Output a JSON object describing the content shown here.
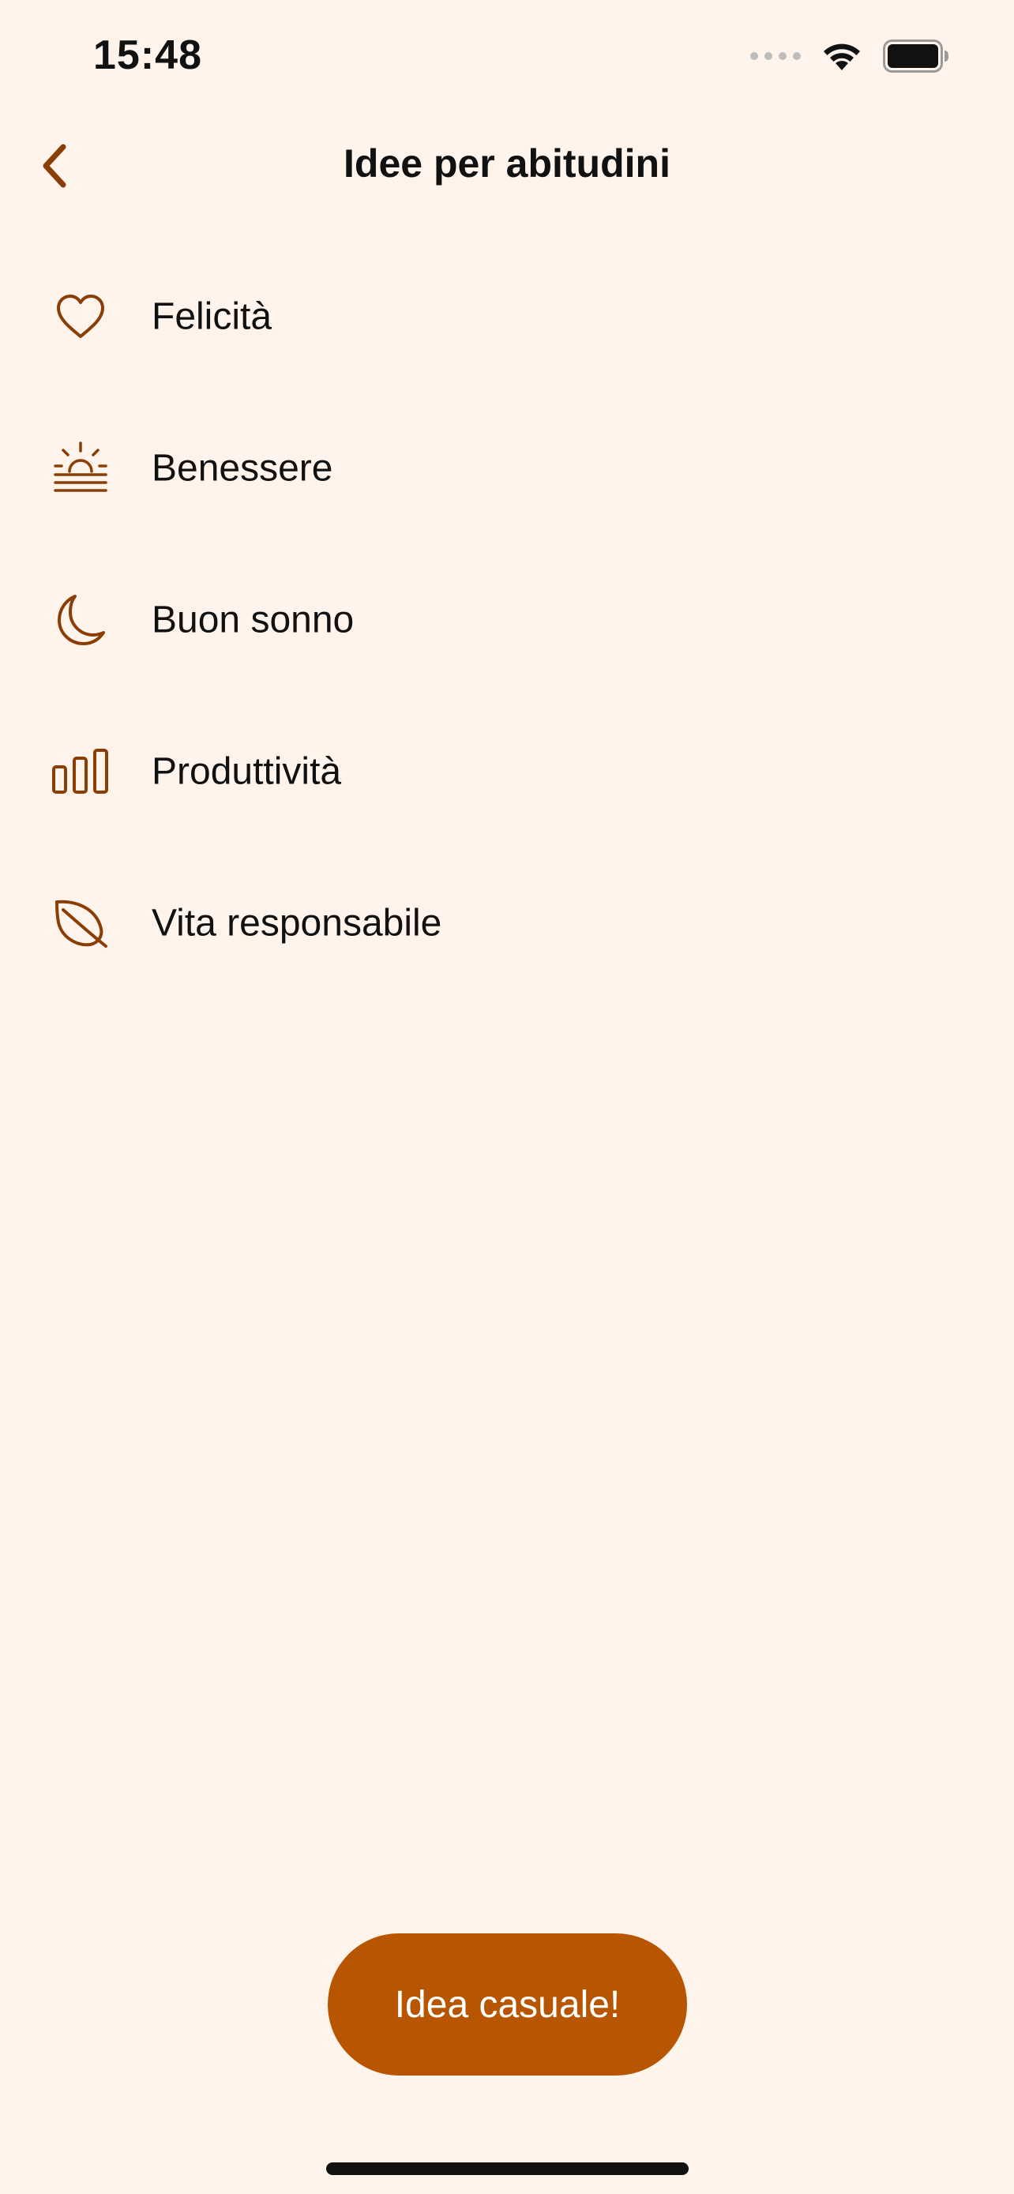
{
  "status_bar": {
    "time": "15:48",
    "icons": [
      "cellular-signal-icon",
      "wifi-icon",
      "battery-icon"
    ]
  },
  "nav": {
    "back_icon": "chevron-left-icon",
    "title": "Idee per abitudini"
  },
  "categories": [
    {
      "label": "Felicità",
      "icon": "heart-icon"
    },
    {
      "label": "Benessere",
      "icon": "sunrise-icon"
    },
    {
      "label": "Buon sonno",
      "icon": "moon-icon"
    },
    {
      "label": "Produttività",
      "icon": "bar-chart-icon"
    },
    {
      "label": "Vita responsabile",
      "icon": "leaf-icon"
    }
  ],
  "random_button": {
    "label": "Idea casuale!"
  },
  "colors": {
    "background": "#FEF4EC",
    "accent": "#B75500",
    "icon": "#8A3E06",
    "text": "#111111"
  }
}
